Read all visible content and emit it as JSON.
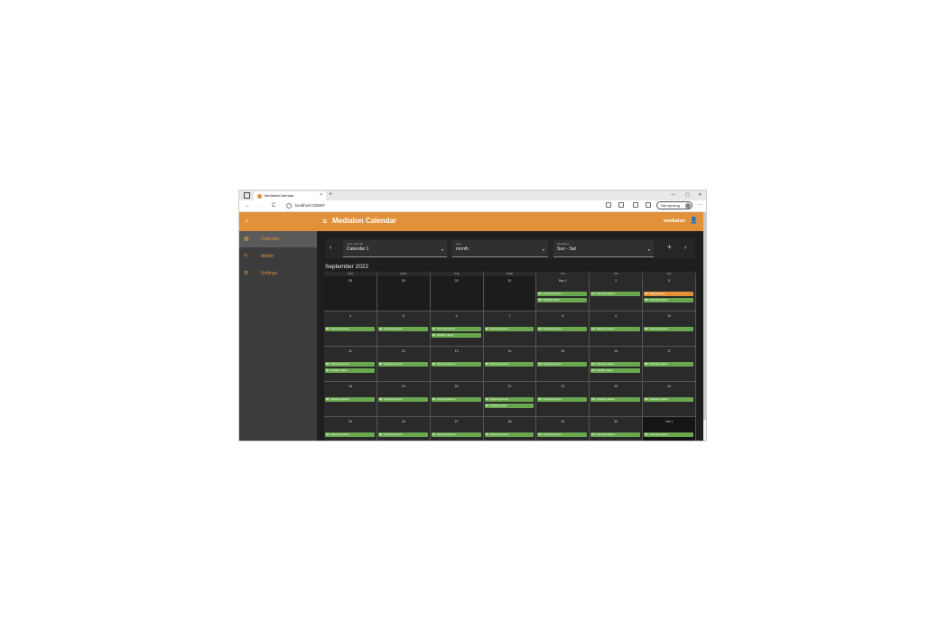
{
  "browser": {
    "tab_title": "MedialonCalendar",
    "tab_close": "×",
    "new_tab": "+",
    "url": "localhost:3256/#",
    "not_syncing": "Not syncing",
    "more": "···",
    "nav": {
      "back": "←",
      "forward": "→",
      "reload": "C"
    },
    "window_controls": {
      "minimize": "—",
      "maximize": "▢",
      "close": "✕"
    }
  },
  "app": {
    "title": "Medialon Calendar",
    "back_glyph": "‹",
    "menu_glyph": "≡",
    "user": "medialon",
    "user_glyph": "👤"
  },
  "sidebar": {
    "items": [
      {
        "label": "Calendar",
        "icon": "calendar-icon",
        "glyph": "▦"
      },
      {
        "label": "Admin",
        "icon": "pencil-icon",
        "glyph": "✎"
      },
      {
        "label": "Settings",
        "icon": "gear-icon",
        "glyph": "⚙"
      }
    ]
  },
  "controls": {
    "prev": "‹",
    "next": "›",
    "add": "+",
    "dropdown_glyph": "▾",
    "view_calendar": {
      "label": "view calendar",
      "value": "Calendar 1"
    },
    "view": {
      "label": "view",
      "value": "month"
    },
    "weekdays": {
      "label": "weekdays",
      "value": "Sun - Sat"
    }
  },
  "month_title": "September 2022",
  "day_headers": [
    "SUN",
    "MON",
    "TUE",
    "WED",
    "THU",
    "FRI",
    "SAT"
  ],
  "colors": {
    "accent": "#e2913a",
    "event_green": "#6aa84f",
    "event_orange": "#e2913a"
  },
  "weeks": [
    {
      "days": [
        {
          "n": "28",
          "other": true,
          "events": []
        },
        {
          "n": "29",
          "other": true,
          "events": []
        },
        {
          "n": "30",
          "other": true,
          "events": []
        },
        {
          "n": "31",
          "other": true,
          "events": []
        },
        {
          "n": "Sep 1",
          "events": [
            {
              "t": "00",
              "name": "Opening Hours",
              "color": "green"
            },
            {
              "t": "00",
              "name": "Facility Lights",
              "color": "green"
            }
          ]
        },
        {
          "n": "2",
          "events": [
            {
              "t": "00",
              "name": "Opening Hours",
              "color": "green"
            }
          ]
        },
        {
          "n": "3",
          "events": [
            {
              "t": "00",
              "name": "Maintenance",
              "color": "orange"
            },
            {
              "t": "00",
              "name": "Opening Hours",
              "color": "green"
            }
          ]
        }
      ]
    },
    {
      "days": [
        {
          "n": "4",
          "events": [
            {
              "t": "00",
              "name": "Opening Hours",
              "color": "green"
            }
          ]
        },
        {
          "n": "5",
          "events": [
            {
              "t": "00",
              "name": "Opening Hours",
              "color": "green"
            }
          ]
        },
        {
          "n": "6",
          "events": [
            {
              "t": "00",
              "name": "Opening Hours",
              "color": "green"
            },
            {
              "t": "00",
              "name": "Facility Lights",
              "color": "green"
            }
          ]
        },
        {
          "n": "7",
          "events": [
            {
              "t": "00",
              "name": "Opening Hours",
              "color": "green"
            }
          ]
        },
        {
          "n": "8",
          "events": [
            {
              "t": "00",
              "name": "Opening Hours",
              "color": "green"
            }
          ]
        },
        {
          "n": "9",
          "events": [
            {
              "t": "00",
              "name": "Opening Hours",
              "color": "green"
            }
          ]
        },
        {
          "n": "10",
          "events": [
            {
              "t": "00",
              "name": "Opening Hours",
              "color": "green"
            }
          ]
        }
      ]
    },
    {
      "days": [
        {
          "n": "11",
          "events": [
            {
              "t": "00",
              "name": "Opening Hours",
              "color": "green"
            },
            {
              "t": "00",
              "name": "Facility Lights",
              "color": "green"
            }
          ]
        },
        {
          "n": "12",
          "events": [
            {
              "t": "00",
              "name": "Opening Hours",
              "color": "green"
            }
          ]
        },
        {
          "n": "13",
          "events": [
            {
              "t": "00",
              "name": "Opening Hours",
              "color": "green"
            }
          ]
        },
        {
          "n": "14",
          "events": [
            {
              "t": "00",
              "name": "Opening Hours",
              "color": "green"
            }
          ]
        },
        {
          "n": "15",
          "events": [
            {
              "t": "00",
              "name": "Opening Hours",
              "color": "green"
            }
          ]
        },
        {
          "n": "16",
          "events": [
            {
              "t": "00",
              "name": "Opening Hours",
              "color": "green"
            },
            {
              "t": "00",
              "name": "Facility Lights",
              "color": "green"
            }
          ]
        },
        {
          "n": "17",
          "events": [
            {
              "t": "00",
              "name": "Opening Hours",
              "color": "green"
            }
          ]
        }
      ]
    },
    {
      "days": [
        {
          "n": "18",
          "events": [
            {
              "t": "00",
              "name": "Opening Hours",
              "color": "green"
            }
          ]
        },
        {
          "n": "19",
          "events": [
            {
              "t": "00",
              "name": "Opening Hours",
              "color": "green"
            }
          ]
        },
        {
          "n": "20",
          "events": [
            {
              "t": "00",
              "name": "Opening Hours",
              "color": "green"
            }
          ]
        },
        {
          "n": "21",
          "events": [
            {
              "t": "00",
              "name": "Opening Hours",
              "color": "green"
            },
            {
              "t": "00",
              "name": "Facility Lights",
              "color": "green"
            }
          ]
        },
        {
          "n": "22",
          "events": [
            {
              "t": "00",
              "name": "Opening Hours",
              "color": "green"
            }
          ]
        },
        {
          "n": "23",
          "events": [
            {
              "t": "00",
              "name": "Opening Hours",
              "color": "green"
            }
          ]
        },
        {
          "n": "24",
          "events": [
            {
              "t": "00",
              "name": "Opening Hours",
              "color": "green"
            }
          ]
        }
      ]
    },
    {
      "days": [
        {
          "n": "25",
          "events": [
            {
              "t": "00",
              "name": "Opening Hours",
              "color": "green"
            }
          ]
        },
        {
          "n": "26",
          "events": [
            {
              "t": "00",
              "name": "Opening Hours",
              "color": "green"
            }
          ]
        },
        {
          "n": "27",
          "events": [
            {
              "t": "00",
              "name": "Opening Hours",
              "color": "green"
            }
          ]
        },
        {
          "n": "28",
          "events": [
            {
              "t": "00",
              "name": "Opening Hours",
              "color": "green"
            }
          ]
        },
        {
          "n": "29",
          "events": [
            {
              "t": "00",
              "name": "Opening Hours",
              "color": "green"
            }
          ]
        },
        {
          "n": "30",
          "events": [
            {
              "t": "00",
              "name": "Opening Hours",
              "color": "green"
            }
          ]
        },
        {
          "n": "Oct 1",
          "other": true,
          "events": [
            {
              "t": "00",
              "name": "Opening Hours",
              "color": "green"
            }
          ]
        }
      ]
    }
  ]
}
